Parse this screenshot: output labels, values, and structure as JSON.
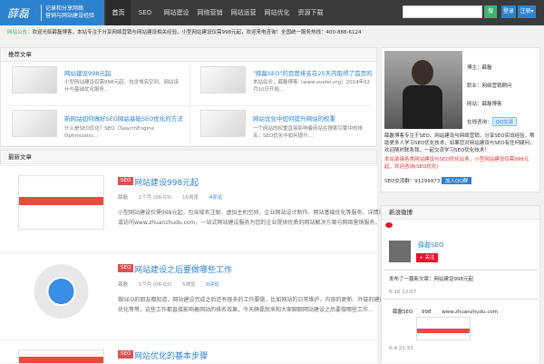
{
  "header": {
    "logo": "薛磊",
    "tagline_1": "记录和分享网络",
    "tagline_2": "营销与网站建设经验",
    "nav": [
      "首页",
      "SEO",
      "网站建设",
      "网络营销",
      "网站运营",
      "网站优化",
      "资源下载"
    ],
    "search_placeholder": "",
    "search_button": "搜",
    "btn_1": "登录",
    "btn_2": "注册▾"
  },
  "notice": {
    "highlight": "网站公告：",
    "text": "欢迎光临薛磊博客，本站专注于分享网络营销与网站建设相关经验，小型网站建设仅需998元起，欢迎来电咨询！全国统一服务热线：400-888-6124"
  },
  "featured": {
    "title": "推荐文章",
    "items": [
      {
        "title": "网站建设998元起",
        "desc": "小型网站建设仅需998元起，包含域名空间、网站设计与基础优化服务..."
      },
      {
        "title": "\"薛磊SEO\"的百度排名在25天内取得了首页的方法",
        "desc": "本站站长，薛磊博客（www.xuelei.org）2014年02月10日开始..."
      },
      {
        "title": "新网站如何做好SEO网站基础SEO优化的方法",
        "desc": "什么是SEO优化？SEO（SearchEngine Optimizatio..."
      },
      {
        "title": "网站优化中如何提升网站的权重",
        "desc": "一个网站的权重直接影响着网站在搜索引擎中的排名，SEO优化中如何提升..."
      }
    ]
  },
  "latest": {
    "title": "最新文章",
    "posts": [
      {
        "tag": "SEO",
        "title": "网站建设998元起",
        "author": "薛磊",
        "date": "1个月 (06-03)",
        "views": "15浏览",
        "comments": "4评论",
        "excerpt": "小型网站建设仅需998元起，包含域名注册、虚拟主机空间、企业网站设计制作、网站基础优化等服务，详情请咨询在线客服或访问www.zhuanzhudu.com，一站式网站建设服务为您的企业提供优质的网站解决方案与网络营销服务，让您的网站脱颖而出ww..."
      },
      {
        "tag": "SEO",
        "title": "网站建设之后要做哪些工作",
        "author": "薛磊",
        "date": "1个月 (06-03)",
        "views": "5浏览",
        "comments": "0评论",
        "excerpt": "做SEO的朋友都知道，网站建设完成之后还有很多的工作要做，比如网站的日常维护、内容的更新、外链的建设、关键词的优化等等，这些工作都直接影响着网站的排名效果，今天薛磊就来和大家聊聊网站建设之后要做哪些工作..."
      },
      {
        "tag": "SEO",
        "title": "网站优化的基本步骤",
        "author": "",
        "date": "",
        "views": "",
        "comments": "",
        "excerpt": ""
      }
    ]
  },
  "profile": {
    "name": "博主：薛磊",
    "job": "职业：网络营销顾问",
    "site": "网站：薛磊博客",
    "qq_label": "在线咨询：",
    "qq_btn": "QQ交谈",
    "desc": "薛磊博客专注于SEO、网站建设与网络营销，分享SEO实战经验，帮助更多人学习SEO优化技术，如果您对网站建设与SEO有任何疑问，欢迎随时联系我，一起交流学习SEO优化技术！",
    "red": "本站承接各类网站建设与SEO优化业务，小型网站建设仅需998元起，欢迎咨询(SEO优化)",
    "group_label": "SEO交流群：",
    "group_num": "91299973",
    "group_btn": "加入QQ群"
  },
  "weibo": {
    "title": "新浪微博",
    "name": "薛磊SEO",
    "follow": "+ 关注",
    "post1": "发布了一篇新文章：网站建设998元起",
    "time1": "6-16 12:07",
    "post2_label": "薛磊SEO",
    "post2_price": "998",
    "post2_url": "www.zhuanzhudu.com",
    "time2": "6-4 21:33"
  }
}
